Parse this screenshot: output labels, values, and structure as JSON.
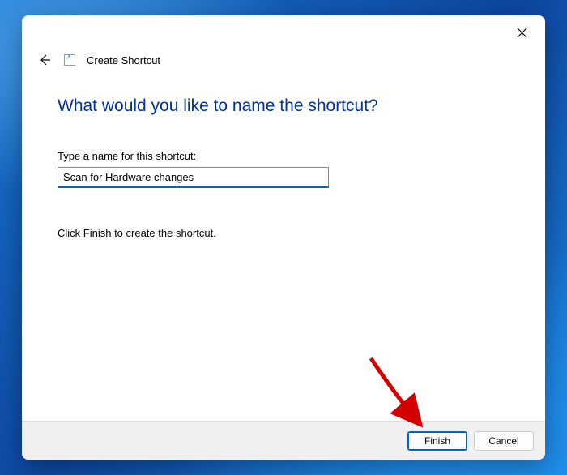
{
  "dialog": {
    "title": "Create Shortcut",
    "heading": "What would you like to name the shortcut?",
    "field_label": "Type a name for this shortcut:",
    "shortcut_name_value": "Scan for Hardware changes",
    "instruction": "Click Finish to create the shortcut.",
    "buttons": {
      "finish": "Finish",
      "cancel": "Cancel"
    }
  }
}
